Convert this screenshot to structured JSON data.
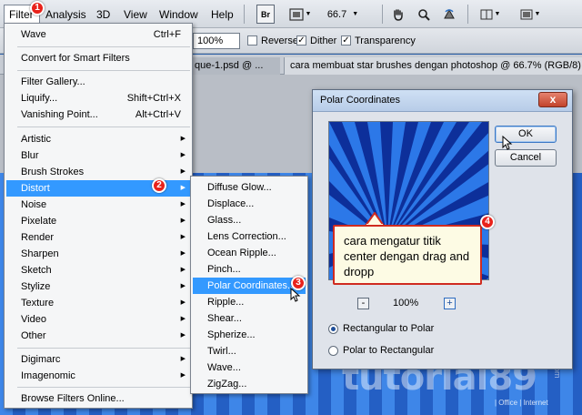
{
  "menubar": {
    "items": [
      "Filter",
      "Analysis",
      "3D",
      "View",
      "Window",
      "Help"
    ],
    "br_label": "Br",
    "zoom": "66.7"
  },
  "options_bar": {
    "zoom_value": "100%",
    "reverse_label": "Reverse",
    "dither_label": "Dither",
    "transparency_label": "Transparency"
  },
  "tabs": [
    {
      "label": "que-1.psd @ ..."
    },
    {
      "label": "cara membuat star brushes dengan photoshop @ 66.7% (RGB/8)"
    }
  ],
  "filter_menu": {
    "top": [
      {
        "label": "Wave",
        "shortcut": "Ctrl+F"
      },
      {
        "label": "Convert for Smart Filters",
        "shortcut": ""
      },
      {
        "label": "Filter Gallery...",
        "shortcut": ""
      },
      {
        "label": "Liquify...",
        "shortcut": "Shift+Ctrl+X"
      },
      {
        "label": "Vanishing Point...",
        "shortcut": "Alt+Ctrl+V"
      }
    ],
    "groups": [
      "Artistic",
      "Blur",
      "Brush Strokes",
      "Distort",
      "Noise",
      "Pixelate",
      "Render",
      "Sharpen",
      "Sketch",
      "Stylize",
      "Texture",
      "Video",
      "Other"
    ],
    "plugins": [
      "Digimarc",
      "Imagenomic"
    ],
    "browse": "Browse Filters Online..."
  },
  "distort_menu": [
    "Diffuse Glow...",
    "Displace...",
    "Glass...",
    "Lens Correction...",
    "Ocean Ripple...",
    "Pinch...",
    "Polar Coordinates...",
    "Ripple...",
    "Shear...",
    "Spherize...",
    "Twirl...",
    "Wave...",
    "ZigZag..."
  ],
  "dialog": {
    "title": "Polar Coordinates",
    "close": "x",
    "ok": "OK",
    "cancel": "Cancel",
    "zoom": "100%",
    "zoom_out": "-",
    "zoom_in": "+",
    "option1": "Rectangular to Polar",
    "option2": "Polar to Rectangular",
    "selected": "Rectangular to Polar"
  },
  "callout": {
    "text": "cara mengatur titik center dengan drag and dropp"
  },
  "badges": [
    "1",
    "2",
    "3",
    "4"
  ],
  "watermark": {
    "text": "tutorial89",
    "sub": "| Office | Internet",
    "com": ".com"
  },
  "colors": {
    "highlight": "#3399ff",
    "badge": "#e8221b",
    "ray_light": "#3e86e8",
    "ray_dark": "#245fc4"
  }
}
